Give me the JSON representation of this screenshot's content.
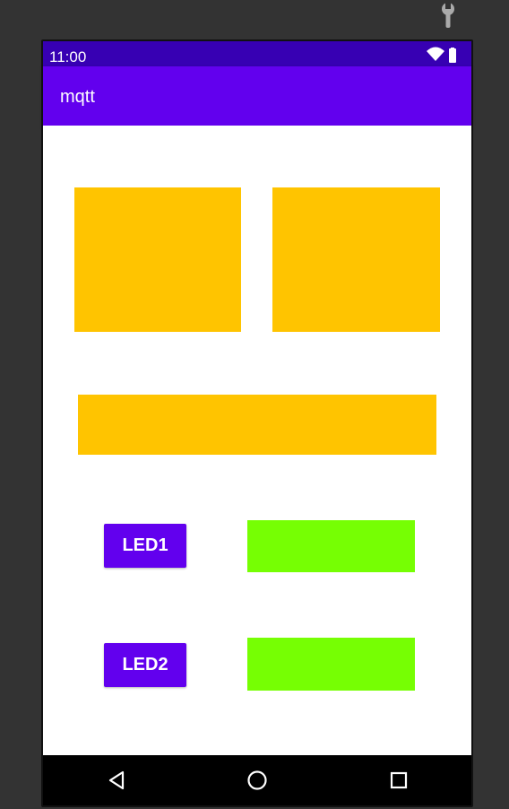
{
  "status_bar": {
    "time": "11:00",
    "icons": [
      "wifi-icon",
      "battery-icon"
    ],
    "color": "#3700b3"
  },
  "app_bar": {
    "title": "mqtt",
    "color": "#6200ee"
  },
  "tiles": {
    "color": "#ffc400"
  },
  "leds": [
    {
      "label": "LED1",
      "indicator_color": "#76ff03"
    },
    {
      "label": "LED2",
      "indicator_color": "#76ff03"
    }
  ],
  "nav_bar": {
    "icons": [
      "back-icon",
      "home-icon",
      "recents-icon"
    ]
  },
  "emulator": {
    "toolbar_icon": "wrench-icon"
  }
}
